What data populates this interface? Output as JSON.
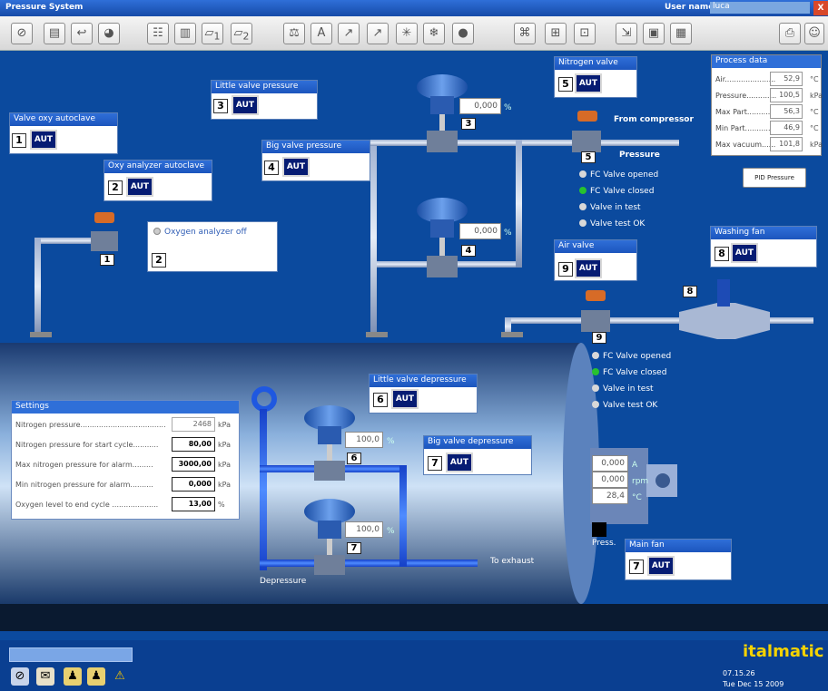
{
  "window": {
    "title": "Pressure System",
    "user_label": "User name :",
    "user_value": "luca",
    "close": "X"
  },
  "toolbar": {
    "icons": [
      "no-entry-icon",
      "document-icon",
      "back-icon",
      "pie-icon",
      "list-icon",
      "chart-icon",
      "folder-1-icon",
      "folder-2-icon",
      "scale-icon",
      "font-icon",
      "trend-1-icon",
      "trend-2-icon",
      "snow-icon",
      "asterisk-icon",
      "globe-icon",
      "binoculars-icon",
      "network-icon",
      "grid-icon",
      "export-icon",
      "view-icon",
      "window-icon",
      "print-icon",
      "user-exit-icon"
    ],
    "subscripts": [
      "1",
      "2",
      "1",
      "2"
    ]
  },
  "panels": {
    "valve_oxy": {
      "title": "Valve oxy autoclave",
      "num": "1",
      "mode": "AUT"
    },
    "oxy_analyzer": {
      "title": "Oxy analyzer autoclave",
      "num": "2",
      "mode": "AUT"
    },
    "little_valve_pressure": {
      "title": "Little valve pressure",
      "num": "3",
      "mode": "AUT"
    },
    "big_valve_pressure": {
      "title": "Big valve pressure",
      "num": "4",
      "mode": "AUT"
    },
    "nitrogen_valve": {
      "title": "Nitrogen valve",
      "num": "5",
      "mode": "AUT"
    },
    "air_valve": {
      "title": "Air valve",
      "num": "9",
      "mode": "AUT"
    },
    "washing_fan": {
      "title": "Washing fan",
      "num": "8",
      "mode": "AUT"
    },
    "little_valve_depressure": {
      "title": "Little valve depressure",
      "num": "6",
      "mode": "AUT"
    },
    "big_valve_depressure": {
      "title": "Big valve depressure",
      "num": "7",
      "mode": "AUT"
    },
    "main_fan": {
      "title": "Main fan",
      "num": "7",
      "mode": "AUT"
    }
  },
  "oxygen_analyzer": {
    "status": "Oxygen analyzer off",
    "num": "2"
  },
  "tags": {
    "t1": "1",
    "t3": "3",
    "t4": "4",
    "t5": "5",
    "t6": "6",
    "t7": "7",
    "t8": "8",
    "t9": "9"
  },
  "valve_values": {
    "v3": "0,000",
    "v4": "0,000",
    "v6": "100,0",
    "v7": "100,0",
    "unit": "%"
  },
  "labels": {
    "from_compressor": "From compressor",
    "pressure": "Pressure",
    "depressure": "Depressure",
    "to_exhaust": "To exhaust",
    "press": "Press."
  },
  "nitrogen_status": [
    {
      "label": "FC Valve opened",
      "color": "#d8d8d8"
    },
    {
      "label": "FC Valve closed",
      "color": "#27c22e"
    },
    {
      "label": "Valve in test",
      "color": "#d8d8d8"
    },
    {
      "label": "Valve test OK",
      "color": "#d8d8d8"
    }
  ],
  "air_status": [
    {
      "label": "FC Valve opened",
      "color": "#d8d8d8"
    },
    {
      "label": "FC Valve closed",
      "color": "#27c22e"
    },
    {
      "label": "Valve in test",
      "color": "#d8d8d8"
    },
    {
      "label": "Valve test OK",
      "color": "#d8d8d8"
    }
  ],
  "process_data": {
    "title": "Process data",
    "rows": [
      {
        "label": "Air......................",
        "value": "52,9",
        "unit": "°C"
      },
      {
        "label": "Pressure.............",
        "value": "100,5",
        "unit": "kPa"
      },
      {
        "label": "Max Part..........",
        "value": "56,3",
        "unit": "°C"
      },
      {
        "label": "Min Part...........",
        "value": "46,9",
        "unit": "°C"
      },
      {
        "label": "Max vacuum......",
        "value": "101,8",
        "unit": "kPa"
      }
    ],
    "pid_button": "PID Pressure"
  },
  "settings": {
    "title": "Settings",
    "rows": [
      {
        "label": "Nitrogen pressure.....................................",
        "value": "2468",
        "unit": "kPa",
        "readonly": true
      },
      {
        "label": "Nitrogen pressure for start cycle...........",
        "value": "80,00",
        "unit": "kPa",
        "readonly": false
      },
      {
        "label": "Max nitrogen pressure for alarm.........",
        "value": "3000,00",
        "unit": "kPa",
        "readonly": false
      },
      {
        "label": "Min nitrogen pressure for alarm..........",
        "value": "0,000",
        "unit": "kPa",
        "readonly": false
      },
      {
        "label": "Oxygen level to end cycle ....................",
        "value": "13,00",
        "unit": "%",
        "readonly": false
      }
    ]
  },
  "motor": {
    "amps": "0,000",
    "amps_unit": "A",
    "rpm": "0,000",
    "rpm_unit": "rpm",
    "temp": "28,4",
    "temp_unit": "°C"
  },
  "footer": {
    "brand": "italmatic",
    "time": "07.15.26",
    "date": "Tue Dec 15 2009"
  },
  "colors": {
    "pipe": "#7c8fb5",
    "pipe_blue": "#1f58e0",
    "panel_header": "#2f6fd8",
    "aut_bg": "#061c73",
    "background": "#0b4a9e"
  }
}
